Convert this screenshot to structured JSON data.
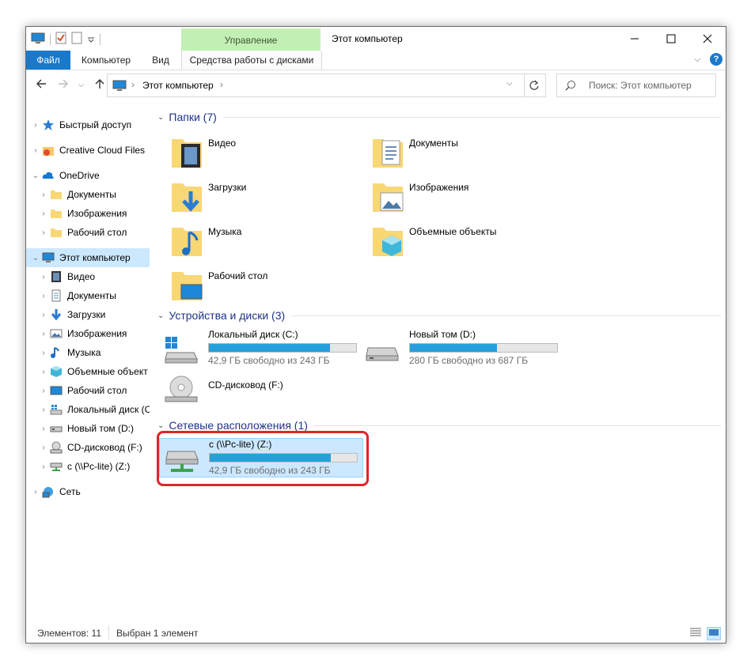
{
  "window": {
    "title": "Этот компьютер",
    "context_group": "Управление"
  },
  "ribbon": {
    "tabs": [
      "Файл",
      "Компьютер",
      "Вид",
      "Средства работы с дисками"
    ]
  },
  "address": {
    "path": "Этот компьютер",
    "search_placeholder": "Поиск: Этот компьютер"
  },
  "nav": {
    "items": [
      {
        "label": "Быстрый доступ",
        "icon": "star-icon"
      },
      {
        "label": "Creative Cloud Files",
        "icon": "creative-cloud-icon"
      },
      {
        "label": "OneDrive",
        "icon": "cloud-icon"
      },
      {
        "label": "Документы",
        "icon": "folder-icon"
      },
      {
        "label": "Изображения",
        "icon": "folder-icon"
      },
      {
        "label": "Рабочий стол",
        "icon": "folder-icon"
      },
      {
        "label": "Этот компьютер",
        "icon": "computer-icon"
      },
      {
        "label": "Видео",
        "icon": "video-icon"
      },
      {
        "label": "Документы",
        "icon": "document-icon"
      },
      {
        "label": "Загрузки",
        "icon": "download-icon"
      },
      {
        "label": "Изображения",
        "icon": "image-icon"
      },
      {
        "label": "Музыка",
        "icon": "music-icon"
      },
      {
        "label": "Объемные объект",
        "icon": "3d-objects-icon"
      },
      {
        "label": "Рабочий стол",
        "icon": "desktop-icon"
      },
      {
        "label": "Локальный диск (С",
        "icon": "windows-drive-icon"
      },
      {
        "label": "Новый том (D:)",
        "icon": "drive-icon"
      },
      {
        "label": "CD-дисковод (F:)",
        "icon": "cd-drive-icon"
      },
      {
        "label": "c (\\\\Pc-lite) (Z:)",
        "icon": "network-drive-icon"
      },
      {
        "label": "Сеть",
        "icon": "network-icon"
      }
    ]
  },
  "groups": {
    "folders": "Папки (7)",
    "devices": "Устройства и диски (3)",
    "network": "Сетевые расположения (1)"
  },
  "folders": [
    {
      "label": "Видео",
      "icon": "video-folder-icon"
    },
    {
      "label": "Документы",
      "icon": "documents-folder-icon"
    },
    {
      "label": "Загрузки",
      "icon": "downloads-folder-icon"
    },
    {
      "label": "Изображения",
      "icon": "pictures-folder-icon"
    },
    {
      "label": "Музыка",
      "icon": "music-folder-icon"
    },
    {
      "label": "Объемные объекты",
      "icon": "3d-objects-folder-icon"
    },
    {
      "label": "Рабочий стол",
      "icon": "desktop-folder-icon"
    }
  ],
  "drives": [
    {
      "name": "Локальный диск (C:)",
      "free": "42,9 ГБ свободно из 243 ГБ",
      "used_fraction": 0.82
    },
    {
      "name": "Новый том (D:)",
      "free": "280 ГБ свободно из 687 ГБ",
      "used_fraction": 0.59
    },
    {
      "name": "CD-дисковод (F:)"
    }
  ],
  "network_drives": [
    {
      "name": "c (\\\\Pc-lite) (Z:)",
      "free": "42,9 ГБ свободно из 243 ГБ",
      "used_fraction": 0.82
    }
  ],
  "status": {
    "items": "Элементов: 11",
    "selected": "Выбран 1 элемент"
  },
  "colors": {
    "accent": "#1979ca",
    "context_tab": "#c2efb3",
    "selection": "#cce8ff",
    "bar_fill": "#26a0da",
    "highlight": "#e0242b"
  }
}
